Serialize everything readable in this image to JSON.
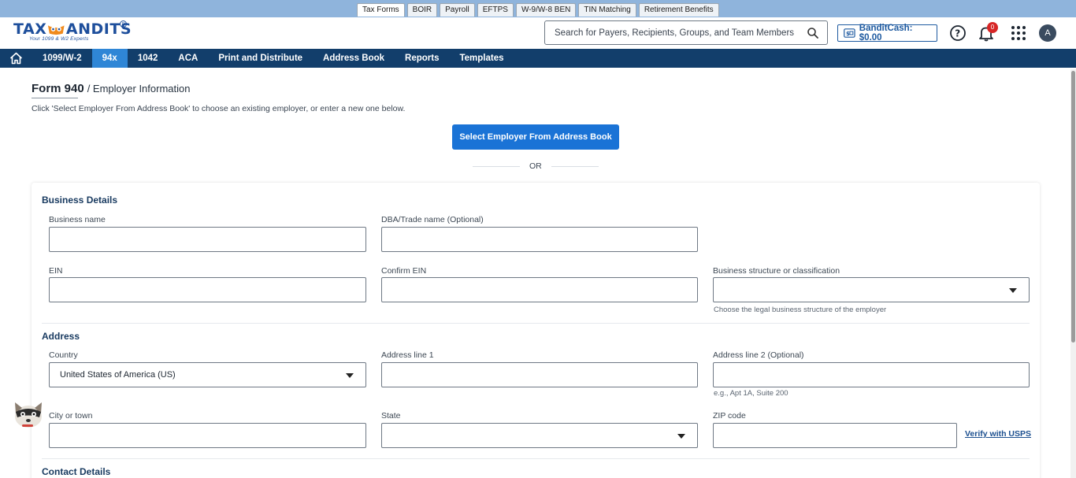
{
  "product_tabs": [
    "Tax Forms",
    "BOIR",
    "Payroll",
    "EFTPS",
    "W-9/W-8 BEN",
    "TIN Matching",
    "Retirement Benefits"
  ],
  "logo": {
    "brand": "TAXBANDITS",
    "tagline": "Your 1099 & W2 Experts"
  },
  "search": {
    "placeholder": "Search for Payers, Recipients, Groups, and Team Members"
  },
  "header": {
    "bandit_cash": "BanditCash: $0.00",
    "notification_count": "0",
    "avatar_initial": "A"
  },
  "nav": {
    "items": [
      "1099/W-2",
      "94x",
      "1042",
      "ACA",
      "Print and Distribute",
      "Address Book",
      "Reports",
      "Templates"
    ],
    "active": "94x"
  },
  "page": {
    "form": "Form 940",
    "breadcrumb": "/ Employer Information",
    "hint": "Click 'Select Employer From Address Book' to choose an existing employer, or enter a new one below.",
    "select_button": "Select Employer From Address Book",
    "or_text": "OR"
  },
  "business": {
    "title": "Business Details",
    "business_name_label": "Business name",
    "dba_label": "DBA/Trade name (Optional)",
    "ein_label": "EIN",
    "confirm_ein_label": "Confirm EIN",
    "structure_label": "Business structure or classification",
    "structure_help": "Choose the legal business structure of the employer"
  },
  "address": {
    "title": "Address",
    "country_label": "Country",
    "country_value": "United States of America (US)",
    "line1_label": "Address line 1",
    "line2_label": "Address line 2 (Optional)",
    "line2_help": "e.g., Apt 1A, Suite 200",
    "city_label": "City or town",
    "state_label": "State",
    "zip_label": "ZIP code",
    "verify_link": "Verify with USPS"
  },
  "contact": {
    "title": "Contact Details"
  },
  "colors": {
    "nav_bg": "#123e6b",
    "nav_active": "#2f86d6",
    "primary_button": "#1a73d6",
    "top_strip": "#8fb4dc",
    "badge": "#d72626"
  }
}
